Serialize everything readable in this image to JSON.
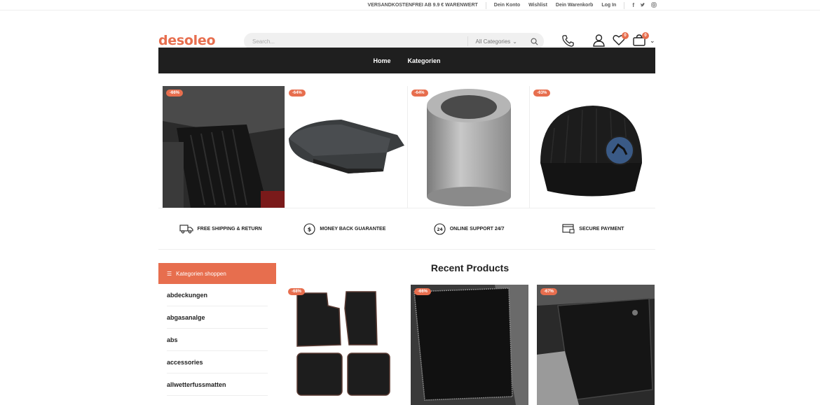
{
  "topbar": {
    "shipping": "VERSANDKOSTENFREI AB 9.9 € WARENWERT",
    "links": [
      "Dein Konto",
      "Wishlist",
      "Dein Warenkorb",
      "Log In"
    ],
    "social_icons": [
      "facebook-icon",
      "twitter-icon",
      "instagram-icon"
    ]
  },
  "header": {
    "logo": "desoleo",
    "search_placeholder": "Search...",
    "search_category": "All Categories",
    "wishlist_count": "0",
    "cart_count": "0"
  },
  "nav": {
    "items": [
      "Home",
      "Kategorien"
    ]
  },
  "hero": {
    "discounts": [
      "-66%",
      "-64%",
      "-64%",
      "-63%"
    ]
  },
  "features": [
    "FREE SHIPPING & RETURN",
    "MONEY BACK GUARANTEE",
    "ONLINE SUPPORT 24/7",
    "SECURE PAYMENT"
  ],
  "sidebar": {
    "title": "Kategorien shoppen",
    "items": [
      "abdeckungen",
      "abgasanalge",
      "abs",
      "accessories",
      "allwetterfussmatten"
    ]
  },
  "recent": {
    "title": "Recent Products",
    "discounts": [
      "-68%",
      "-66%",
      "-67%"
    ]
  },
  "colors": {
    "accent": "#e76e4e",
    "nav_bg": "#1f1f1f"
  }
}
